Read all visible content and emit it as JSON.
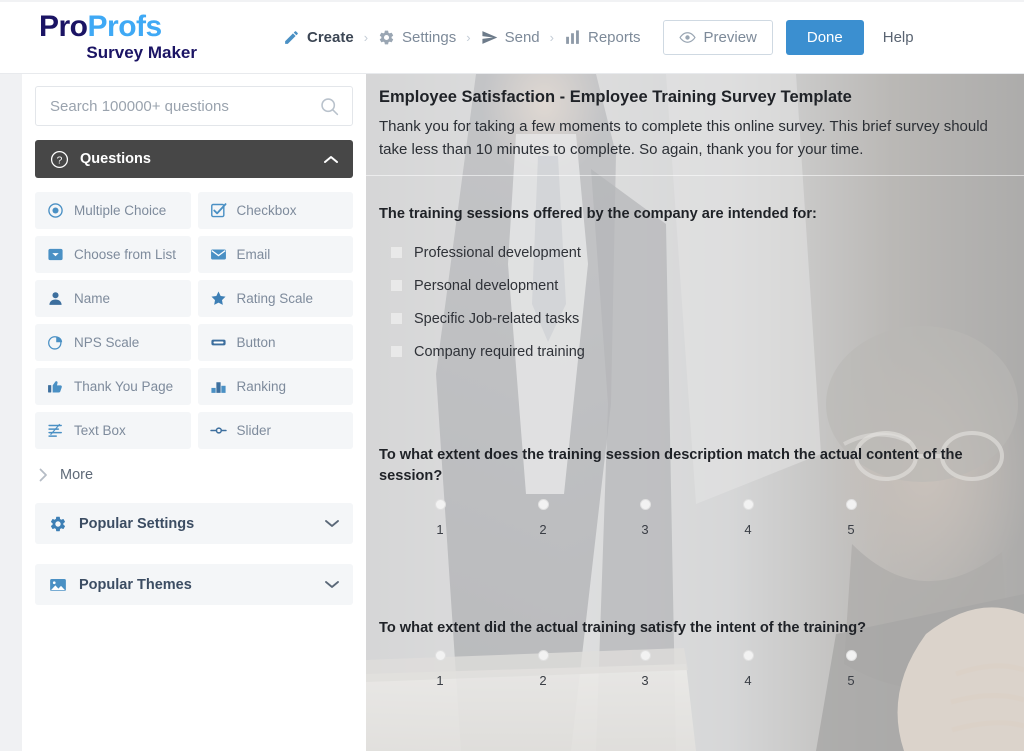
{
  "brand": {
    "name_part1": "Pro",
    "name_part2": "Profs",
    "subtitle": "Survey Maker",
    "color_dark": "#1b1464",
    "color_light": "#3fa9f5"
  },
  "topbar": {
    "nav": [
      {
        "label": "Create",
        "icon": "pencil-icon",
        "active": true
      },
      {
        "label": "Settings",
        "icon": "gear-icon",
        "active": false
      },
      {
        "label": "Send",
        "icon": "paper-plane-icon",
        "active": false
      },
      {
        "label": "Reports",
        "icon": "bar-chart-icon",
        "active": false
      }
    ],
    "separator": "›",
    "preview_label": "Preview",
    "preview_icon": "eye-icon",
    "done_label": "Done",
    "done_color": "#3b8fd0",
    "help_label": "Help"
  },
  "sidebar": {
    "search": {
      "placeholder": "Search 100000+ questions",
      "value": "",
      "icon": "search-icon"
    },
    "questions_panel": {
      "title": "Questions",
      "icon": "question-circle-icon",
      "chevron": "chevron-up-icon",
      "expanded": true,
      "types": [
        {
          "label": "Multiple Choice",
          "icon": "radio-button-icon"
        },
        {
          "label": "Checkbox",
          "icon": "checkbox-icon"
        },
        {
          "label": "Choose from List",
          "icon": "dropdown-icon"
        },
        {
          "label": "Email",
          "icon": "envelope-icon"
        },
        {
          "label": "Name",
          "icon": "person-icon"
        },
        {
          "label": "Rating Scale",
          "icon": "star-icon"
        },
        {
          "label": "NPS Scale",
          "icon": "pie-chart-icon"
        },
        {
          "label": "Button",
          "icon": "button-icon"
        },
        {
          "label": "Thank You Page",
          "icon": "thumbs-up-icon"
        },
        {
          "label": "Ranking",
          "icon": "bar-ranking-icon"
        },
        {
          "label": "Text Box",
          "icon": "text-lines-icon"
        },
        {
          "label": "Slider",
          "icon": "slider-icon"
        }
      ],
      "more_label": "More",
      "more_icon": "chevron-right-icon"
    },
    "sections": [
      {
        "label": "Popular Settings",
        "icon": "gear-icon",
        "chevron": "chevron-down-icon"
      },
      {
        "label": "Popular Themes",
        "icon": "image-icon",
        "chevron": "chevron-down-icon"
      }
    ]
  },
  "survey": {
    "title": "Employee Satisfaction - Employee Training Survey Template",
    "description": "Thank you for taking a few moments to complete this online survey.  This brief survey should take less than 10 minutes to complete.  So again, thank you for your time.",
    "questions": [
      {
        "type": "checkbox",
        "text": "The training sessions offered by the company are intended for:",
        "options": [
          "Professional development",
          "Personal development",
          "Specific Job-related tasks",
          "Company required training"
        ]
      },
      {
        "type": "rating",
        "text": "To what extent does the training session description match the actual content of the session?",
        "scale": [
          "1",
          "2",
          "3",
          "4",
          "5"
        ]
      },
      {
        "type": "rating",
        "text": "To what extent did the actual training satisfy the intent of the training?",
        "scale": [
          "1",
          "2",
          "3",
          "4",
          "5"
        ]
      }
    ]
  }
}
